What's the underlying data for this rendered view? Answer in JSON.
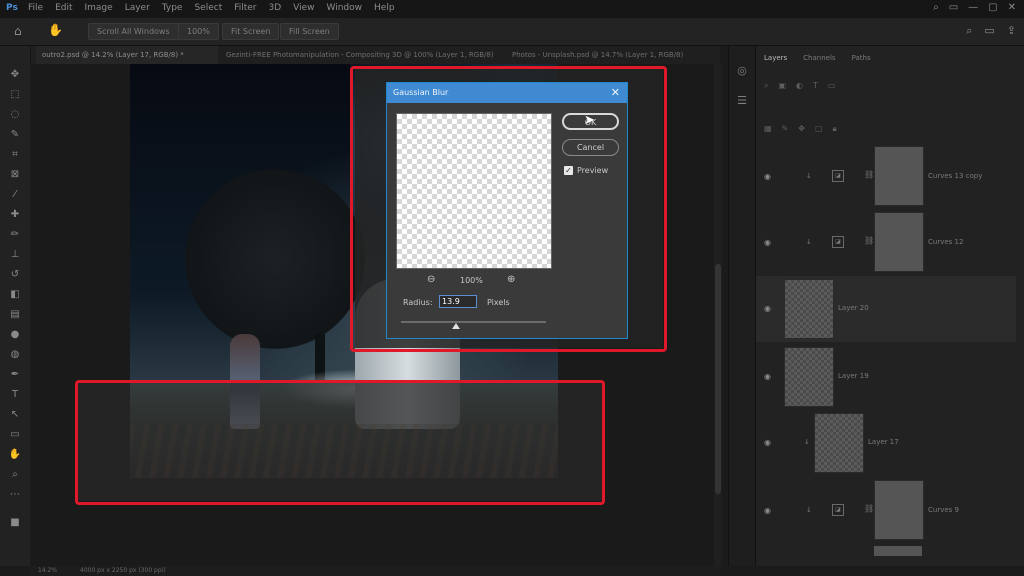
{
  "menubar": {
    "logo": "Ps",
    "items": [
      "File",
      "Edit",
      "Image",
      "Layer",
      "Type",
      "Select",
      "Filter",
      "3D",
      "View",
      "Window",
      "Help"
    ],
    "window_controls": [
      "⌕",
      "▭",
      "—",
      "▢",
      "✕"
    ]
  },
  "options_bar": {
    "scroll_all": "Scroll All Windows",
    "zoom_100": "100%",
    "fit_screen": "Fit Screen",
    "fill_screen": "Fill Screen"
  },
  "doc_tabs": [
    "outro2.psd @ 14.2% (Layer 17, RGB/8) *",
    "Gezinti-FREE Photomanipulation - Compositing 3D @ 100% (Layer 1, RGB/8)",
    "Photos - Unsplash.psd @ 14.7% (Layer 1, RGB/8)"
  ],
  "dialog": {
    "title": "Gaussian Blur",
    "close_glyph": "✕",
    "ok_label": "OK",
    "cancel_label": "Cancel",
    "preview_label": "Preview",
    "preview_checked": true,
    "zoom_level": "100%",
    "radius_label": "Radius:",
    "radius_value": "13.9",
    "radius_units": "Pixels",
    "slider_fraction": 0.38
  },
  "layers_panel": {
    "tabs": [
      "Layers",
      "Channels",
      "Paths"
    ],
    "active_tab": "Layers",
    "layers": [
      {
        "name": "Curves 13 copy",
        "type": "adjustment",
        "visible": true
      },
      {
        "name": "Curves 12",
        "type": "adjustment",
        "visible": true
      },
      {
        "name": "Layer 20",
        "type": "pixel",
        "visible": true,
        "selected": true
      },
      {
        "name": "Layer 19",
        "type": "pixel",
        "visible": true
      },
      {
        "name": "Layer 17",
        "type": "pixel",
        "visible": true,
        "clipped": true
      },
      {
        "name": "Curves 9",
        "type": "adjustment",
        "visible": true
      }
    ]
  },
  "status_bar": {
    "zoom": "14.2%",
    "doc_size": "4000 px x 2250 px (300 ppi)"
  },
  "colors": {
    "highlight": "#e0192a",
    "dialog_title": "#3f8ad1",
    "background": "#1b1b1b"
  }
}
